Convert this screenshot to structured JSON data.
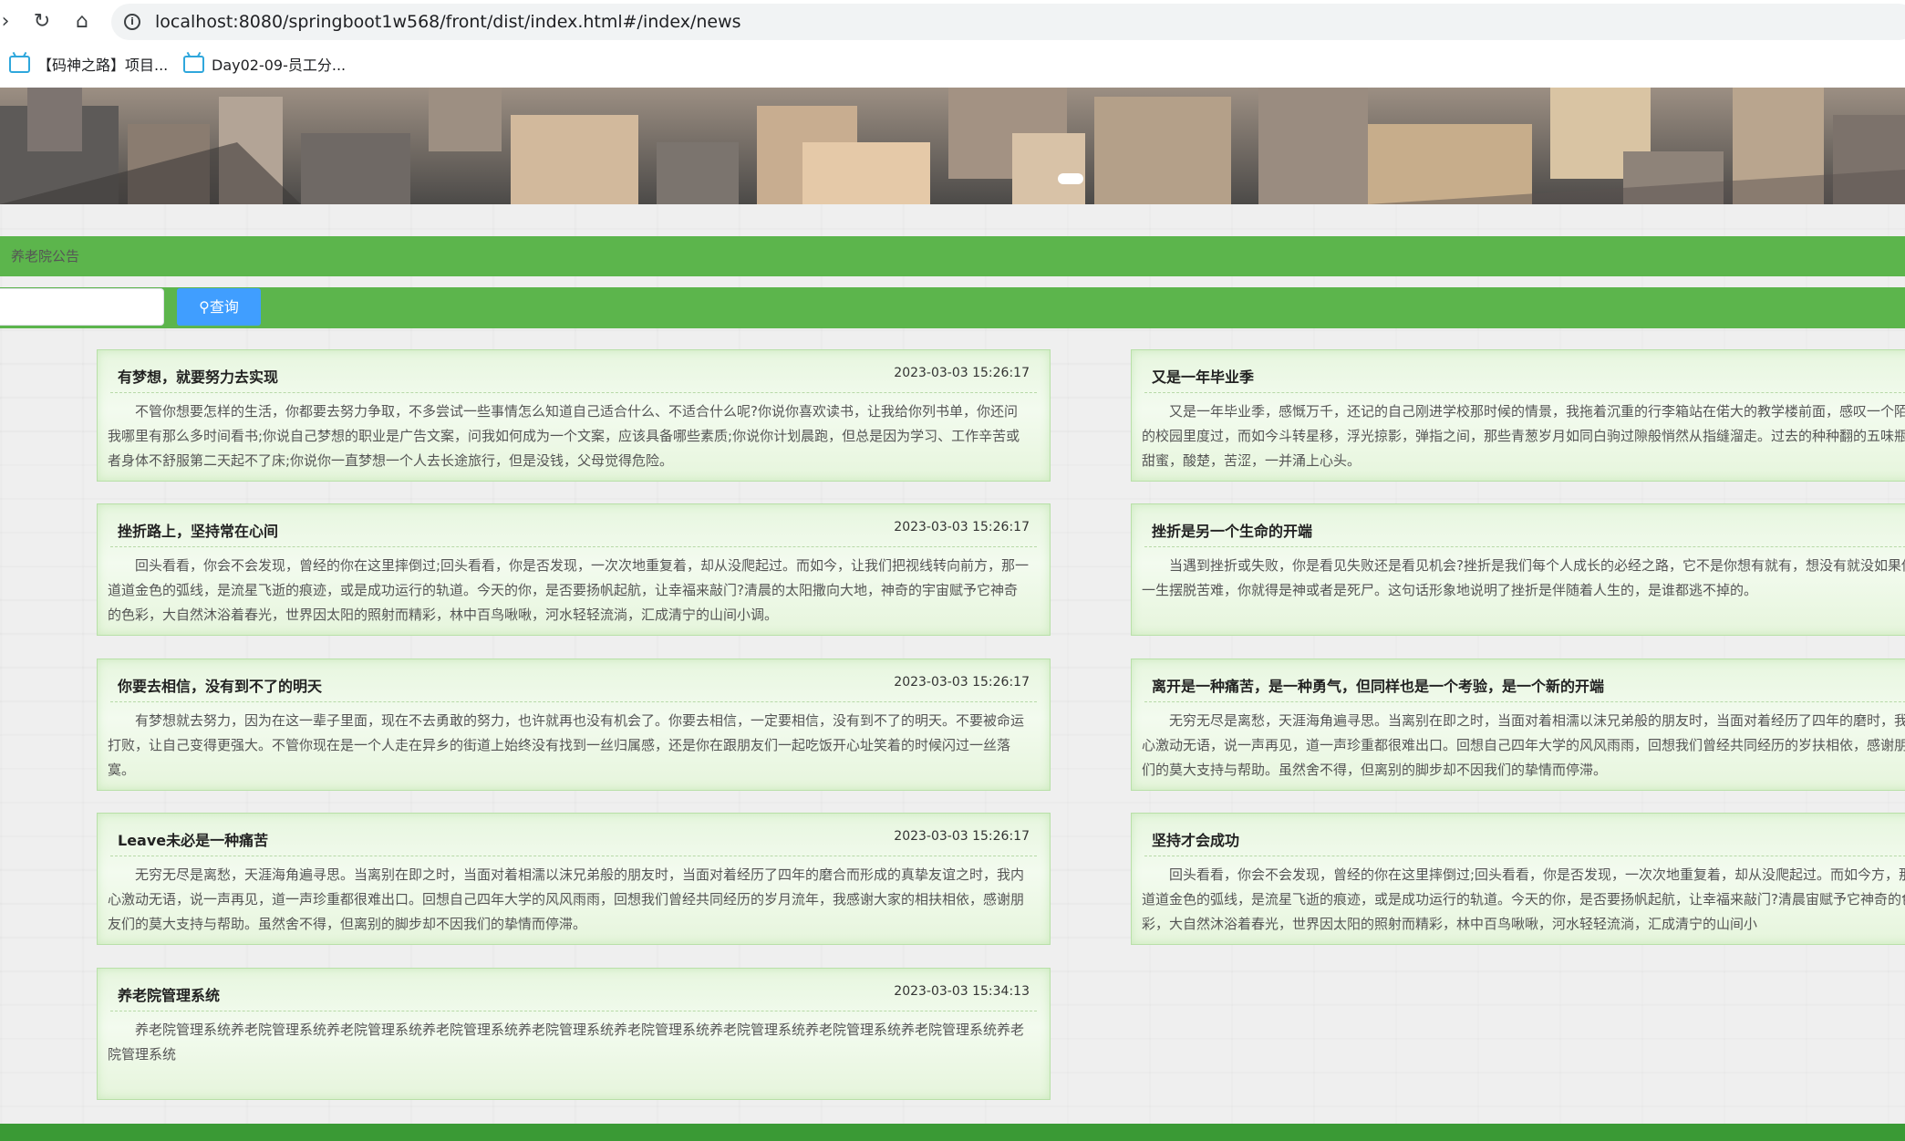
{
  "browser": {
    "url": "localhost:8080/springboot1w568/front/dist/index.html#/index/news",
    "bookmarks": [
      "【码神之路】项目...",
      "Day02-09-员工分..."
    ]
  },
  "breadcrumb": "养老院公告",
  "search": {
    "placeholder": "",
    "button_label": "查询"
  },
  "news": [
    {
      "title": "有梦想，就要努力去实现",
      "time": "2023-03-03 15:26:17",
      "content": "不管你想要怎样的生活，你都要去努力争取，不多尝试一些事情怎么知道自己适合什么、不适合什么呢?你说你喜欢读书，让我给你列书单，你还问我哪里有那么多时间看书;你说自己梦想的职业是广告文案，问我如何成为一个文案，应该具备哪些素质;你说你计划晨跑，但总是因为学习、工作辛苦或者身体不舒服第二天起不了床;你说你一直梦想一个人去长途旅行，但是没钱，父母觉得危险。"
    },
    {
      "title": "又是一年毕业季",
      "time": "",
      "content": "又是一年毕业季，感慨万千，还记的自己刚进学校那时候的情景，我拖着沉重的行李箱站在偌大的教学楼前面，感叹一个陌生的校园里度过，而如今斗转星移，浮光掠影，弹指之间，那些青葱岁月如同白驹过隙般悄然从指缝溜走。过去的种种翻的五味瓶，甜蜜，酸楚，苦涩，一并涌上心头。"
    },
    {
      "title": "挫折路上，坚持常在心间",
      "time": "2023-03-03 15:26:17",
      "content": "回头看看，你会不会发现，曾经的你在这里摔倒过;回头看看，你是否发现，一次次地重复着，却从没爬起过。而如今，让我们把视线转向前方，那一道道金色的弧线，是流星飞逝的痕迹，或是成功运行的轨道。今天的你，是否要扬帆起航，让幸福来敲门?清晨的太阳撒向大地，神奇的宇宙赋予它神奇的色彩，大自然沐浴着春光，世界因太阳的照射而精彩，林中百鸟啾啾，河水轻轻流淌，汇成清宁的山间小调。"
    },
    {
      "title": "挫折是另一个生命的开端",
      "time": "",
      "content": "当遇到挫折或失败，你是看见失败还是看见机会?挫折是我们每个人成长的必经之路，它不是你想有就有，想没有就没如果你想一生摆脱苦难，你就得是神或者是死尸。这句话形象地说明了挫折是伴随着人生的，是谁都逃不掉的。"
    },
    {
      "title": "你要去相信，没有到不了的明天",
      "time": "2023-03-03 15:26:17",
      "content": "有梦想就去努力，因为在这一辈子里面，现在不去勇敢的努力，也许就再也没有机会了。你要去相信，一定要相信，没有到不了的明天。不要被命运打败，让自己变得更强大。不管你现在是一个人走在异乡的街道上始终没有找到一丝归属感，还是你在跟朋友们一起吃饭开心址笑着的时候闪过一丝落寞。"
    },
    {
      "title": "离开是一种痛苦，是一种勇气，但同样也是一个考验，是一个新的开端",
      "time": "",
      "content": "无穷无尽是离愁，天涯海角遍寻思。当离别在即之时，当面对着相濡以沫兄弟般的朋友时，当面对着经历了四年的磨时，我内心激动无语，说一声再见，道一声珍重都很难出口。回想自己四年大学的风风雨雨，回想我们曾经共同经历的岁扶相依，感谢朋友们的莫大支持与帮助。虽然舍不得，但离别的脚步却不因我们的挚情而停滞。"
    },
    {
      "title": "Leave未必是一种痛苦",
      "time": "2023-03-03 15:26:17",
      "content": "无穷无尽是离愁，天涯海角遍寻思。当离别在即之时，当面对着相濡以沫兄弟般的朋友时，当面对着经历了四年的磨合而形成的真挚友谊之时，我内心激动无语，说一声再见，道一声珍重都很难出口。回想自己四年大学的风风雨雨，回想我们曾经共同经历的岁月流年，我感谢大家的相扶相依，感谢朋友们的莫大支持与帮助。虽然舍不得，但离别的脚步却不因我们的挚情而停滞。"
    },
    {
      "title": "坚持才会成功",
      "time": "",
      "content": "回头看看，你会不会发现，曾经的你在这里摔倒过;回头看看，你是否发现，一次次地重复着，却从没爬起过。而如今方，那一道道金色的弧线，是流星飞逝的痕迹，或是成功运行的轨道。今天的你，是否要扬帆起航，让幸福来敲门?清晨宙赋予它神奇的色彩，大自然沐浴着春光，世界因太阳的照射而精彩，林中百鸟啾啾，河水轻轻流淌，汇成清宁的山间小"
    },
    {
      "title": "养老院管理系统",
      "time": "2023-03-03 15:34:13",
      "content": "养老院管理系统养老院管理系统养老院管理系统养老院管理系统养老院管理系统养老院管理系统养老院管理系统养老院管理系统养老院管理系统养老院管理系统"
    }
  ]
}
